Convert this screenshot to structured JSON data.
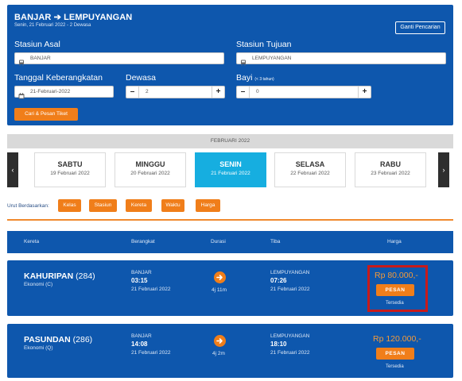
{
  "route": {
    "title": "BANJAR ➔ LEMPUYANGAN",
    "subtitle": "Senin, 21 Februari 2022 - 2 Dewasa",
    "change_label": "Ganti Pencarian"
  },
  "form": {
    "origin_label": "Stasiun Asal",
    "origin_value": "BANJAR",
    "destination_label": "Stasiun Tujuan",
    "destination_value": "LEMPUYANGAN",
    "date_label": "Tanggal Keberangkatan",
    "date_value": "21-Februari-2022",
    "adult_label": "Dewasa",
    "adult_value": "2",
    "infant_label": "Bayi",
    "infant_note": "(< 3 tahun)",
    "infant_value": "0",
    "search_label": "Cari & Pesan Tiket"
  },
  "calendar": {
    "month": "FEBRUARI 2022",
    "days": [
      {
        "name": "SABTU",
        "date": "19 Februari 2022"
      },
      {
        "name": "MINGGU",
        "date": "20 Februari 2022"
      },
      {
        "name": "SENIN",
        "date": "21 Februari 2022"
      },
      {
        "name": "SELASA",
        "date": "22 Februari 2022"
      },
      {
        "name": "RABU",
        "date": "23 Februari 2022"
      }
    ],
    "prev_icon": "‹",
    "next_icon": "›"
  },
  "sort": {
    "label": "Urut Berdasarkan:",
    "options": [
      "Kelas",
      "Stasiun",
      "Kereta",
      "Waktu",
      "Harga"
    ]
  },
  "results_header": {
    "train": "Kereta",
    "depart": "Berangkat",
    "duration": "Durasi",
    "arrive": "Tiba",
    "price": "Harga"
  },
  "trains": [
    {
      "name": "KAHURIPAN",
      "number": "(284)",
      "class": "Ekonomi (C)",
      "from": "BANJAR",
      "depart_time": "03:15",
      "depart_date": "21 Februari 2022",
      "duration": "4j 11m",
      "to": "LEMPUYANGAN",
      "arrive_time": "07:26",
      "arrive_date": "21 Februari 2022",
      "price": "Rp 80.000,-",
      "book_label": "PESAN",
      "status": "Tersedia"
    },
    {
      "name": "PASUNDAN",
      "number": "(286)",
      "class": "Ekonomi (Q)",
      "from": "BANJAR",
      "depart_time": "14:08",
      "depart_date": "21 Februari 2022",
      "duration": "4j 2m",
      "to": "LEMPUYANGAN",
      "arrive_time": "18:10",
      "arrive_date": "21 Februari 2022",
      "price": "Rp 120.000,-",
      "book_label": "PESAN",
      "status": "Tersedia"
    }
  ],
  "colors": {
    "primary": "#0e57ad",
    "accent": "#f07e1a",
    "active_day": "#16aee0",
    "highlight": "#c81a1a"
  }
}
